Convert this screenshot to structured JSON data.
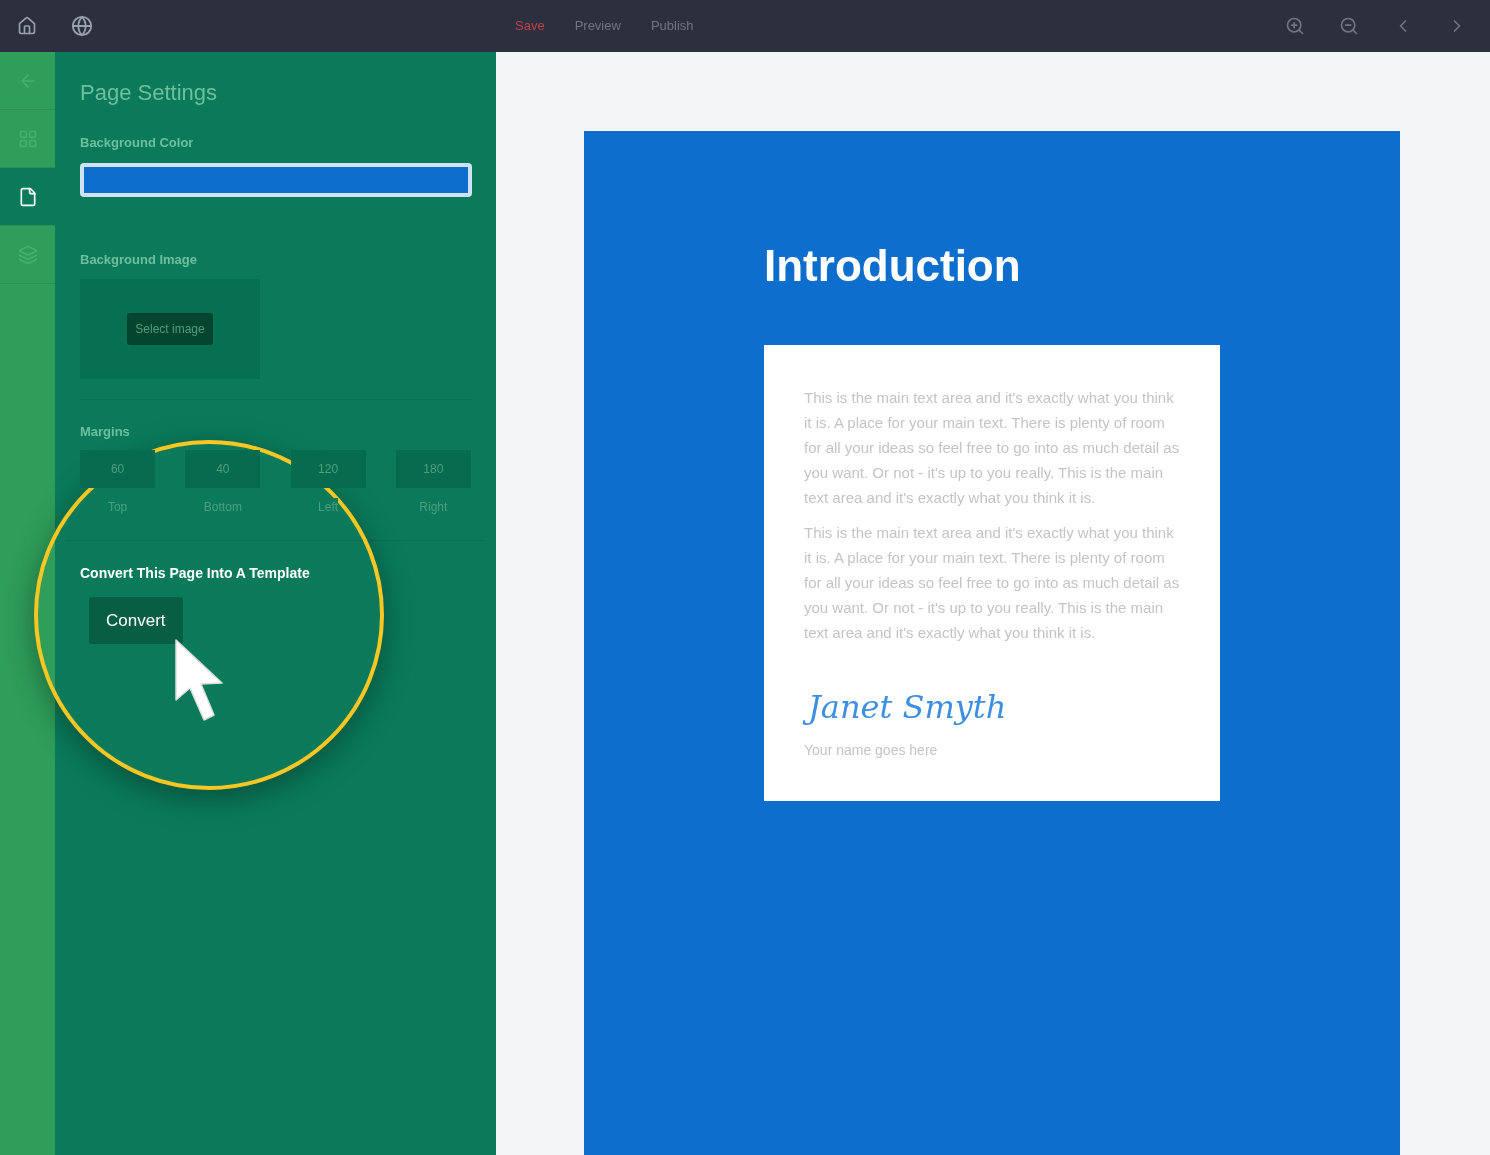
{
  "top_bar": {
    "tabs": [
      {
        "label": "Save",
        "selected": true
      },
      {
        "label": "Preview",
        "selected": false
      },
      {
        "label": "Publish",
        "selected": false
      }
    ]
  },
  "rail": {
    "items": [
      {
        "kind": "back",
        "selected": false
      },
      {
        "kind": "grid",
        "selected": false
      },
      {
        "kind": "page",
        "selected": true
      },
      {
        "kind": "layers",
        "selected": false
      }
    ]
  },
  "panel": {
    "title": "Page Settings",
    "background_color": {
      "label": "Background Color",
      "color": "#0d6ecd"
    },
    "background_image": {
      "label": "Background Image",
      "button": "Select image"
    },
    "margins": {
      "label": "Margins",
      "fields": [
        {
          "value": "60",
          "label": "Top"
        },
        {
          "value": "40",
          "label": "Bottom"
        },
        {
          "value": "120",
          "label": "Left"
        },
        {
          "value": "180",
          "label": "Right"
        }
      ]
    },
    "template": {
      "heading": "Convert This Page Into A Template",
      "button": "Convert"
    }
  },
  "page": {
    "title": "Introduction",
    "paragraphs": [
      "This is the main text area and it's exactly what you think it is. A place for your main text. There is plenty of room for all your ideas so feel free to go into as much detail as you want. Or not - it's up to you really. This is the main text area and it's exactly what you think it is.",
      "This is the main text area and it's exactly what you think it is. A place for your main text. There is plenty of room for all your ideas so feel free to go into as much detail as you want. Or not - it's up to you really. This is the main text area and it's exactly what you think it is."
    ],
    "signature": "Janet Smyth",
    "caption": "Your name goes here"
  }
}
